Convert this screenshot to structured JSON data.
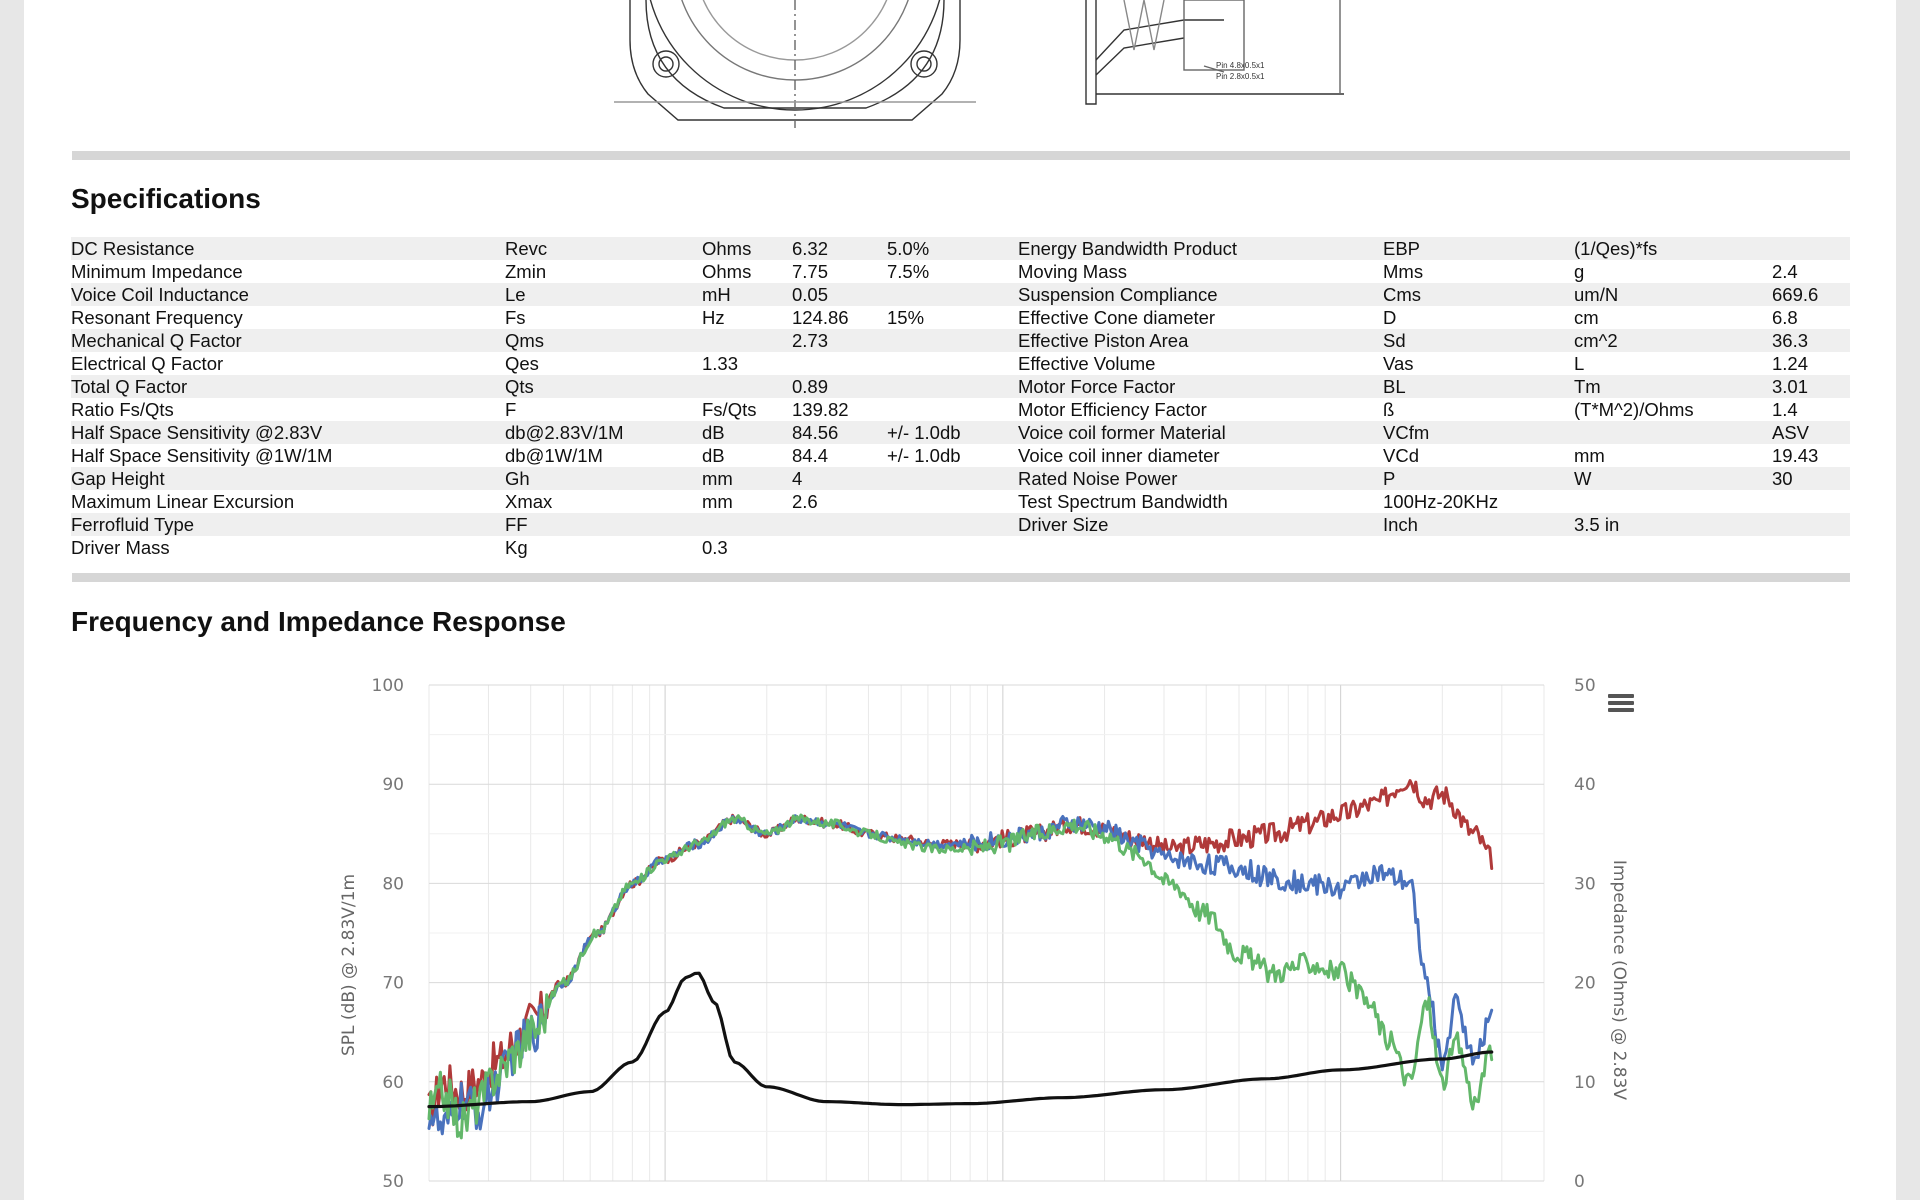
{
  "sections": {
    "specifications_title": "Specifications",
    "response_title": "Frequency and Impedance Response"
  },
  "drawing": {
    "note_line1": "Pin 4.8x0.5x1",
    "note_line2": "Pin 2.8x0.5x1"
  },
  "spec_rows": [
    [
      "DC Resistance",
      "Revc",
      "Ohms",
      "6.32",
      "5.0%",
      "Energy Bandwidth Product",
      "EBP",
      "(1/Qes)*fs",
      ""
    ],
    [
      "Minimum Impedance",
      "Zmin",
      "Ohms",
      "7.75",
      "7.5%",
      "Moving Mass",
      "Mms",
      "g",
      "2.4"
    ],
    [
      "Voice Coil Inductance",
      "Le",
      "mH",
      "0.05",
      "",
      "Suspension Compliance",
      "Cms",
      "um/N",
      "669.6"
    ],
    [
      "Resonant Frequency",
      "Fs",
      "Hz",
      "124.86",
      "15%",
      "Effective Cone diameter",
      "D",
      "cm",
      "6.8"
    ],
    [
      "Mechanical Q Factor",
      "Qms",
      "",
      "2.73",
      "",
      "Effective Piston Area",
      "Sd",
      "cm^2",
      "36.3"
    ],
    [
      "Electrical Q Factor",
      "Qes",
      "1.33",
      "",
      "",
      "Effective Volume",
      "Vas",
      "L",
      "1.24"
    ],
    [
      "Total Q Factor",
      "Qts",
      "",
      "0.89",
      "",
      "Motor Force Factor",
      "BL",
      "Tm",
      "3.01"
    ],
    [
      "Ratio Fs/Qts",
      "F",
      "Fs/Qts",
      "139.82",
      "",
      "Motor Efficiency Factor",
      "ß",
      "(T*M^2)/Ohms",
      "1.4"
    ],
    [
      "Half Space Sensitivity @2.83V",
      "db@2.83V/1M",
      "dB",
      "84.56",
      "+/- 1.0db",
      "Voice coil former Material",
      "VCfm",
      "",
      "ASV"
    ],
    [
      "Half Space Sensitivity @1W/1M",
      "db@1W/1M",
      "dB",
      "84.4",
      "+/- 1.0db",
      "Voice coil inner diameter",
      "VCd",
      "mm",
      "19.43"
    ],
    [
      "Gap Height",
      "Gh",
      "mm",
      "4",
      "",
      "Rated Noise Power",
      "P",
      "W",
      "30"
    ],
    [
      "Maximum Linear Excursion",
      "Xmax",
      "mm",
      "2.6",
      "",
      "Test Spectrum Bandwidth",
      "100Hz-20KHz",
      "",
      ""
    ],
    [
      "Ferrofluid Type",
      "FF",
      "",
      "",
      "",
      "Driver Size",
      "Inch",
      "3.5 in",
      ""
    ],
    [
      "Driver Mass",
      "Kg",
      "0.3",
      "",
      "",
      "",
      "",
      "",
      ""
    ]
  ],
  "chart_data": {
    "type": "line",
    "xlabel": "",
    "ylabel": "SPL (dB) @ 2.83V/1m",
    "y2label": "Impedance (Ohms) @ 2.83V",
    "ylim": [
      50,
      100
    ],
    "y2lim": [
      0,
      50
    ],
    "yticks": [
      "100",
      "90",
      "80",
      "70",
      "60",
      "50"
    ],
    "y2ticks": [
      "50",
      "40",
      "30",
      "20",
      "10",
      "0"
    ],
    "xlim_hz": [
      20,
      40000
    ],
    "grid": true,
    "colors": {
      "red": "#b03a3a",
      "blue": "#4a72bd",
      "green": "#63b76a",
      "impedance": "#111111"
    },
    "series": [
      {
        "color_name": "red",
        "axis": "left",
        "points": [
          [
            20,
            57
          ],
          [
            22,
            60
          ],
          [
            25,
            59
          ],
          [
            28,
            60
          ],
          [
            32,
            62
          ],
          [
            36,
            64
          ],
          [
            40,
            66
          ],
          [
            50,
            70
          ],
          [
            63,
            75
          ],
          [
            80,
            80
          ],
          [
            100,
            82.5
          ],
          [
            125,
            84
          ],
          [
            160,
            86.5
          ],
          [
            200,
            85
          ],
          [
            250,
            86.5
          ],
          [
            315,
            86
          ],
          [
            400,
            85
          ],
          [
            500,
            84.5
          ],
          [
            630,
            84
          ],
          [
            800,
            84
          ],
          [
            1000,
            84.5
          ],
          [
            1250,
            85
          ],
          [
            1600,
            86
          ],
          [
            2000,
            85.5
          ],
          [
            2500,
            84.5
          ],
          [
            3150,
            83.5
          ],
          [
            4000,
            84
          ],
          [
            5000,
            84.5
          ],
          [
            6300,
            85
          ],
          [
            8000,
            86
          ],
          [
            10000,
            87
          ],
          [
            12500,
            88
          ],
          [
            16000,
            90.5
          ],
          [
            18000,
            88.5
          ],
          [
            20000,
            89
          ],
          [
            25000,
            85
          ],
          [
            28000,
            82.5
          ]
        ]
      },
      {
        "color_name": "blue",
        "axis": "left",
        "points": [
          [
            20,
            57
          ],
          [
            22,
            55
          ],
          [
            25,
            58
          ],
          [
            28,
            57
          ],
          [
            32,
            60
          ],
          [
            36,
            63
          ],
          [
            40,
            65
          ],
          [
            50,
            70
          ],
          [
            63,
            75
          ],
          [
            80,
            80
          ],
          [
            100,
            82.5
          ],
          [
            125,
            84
          ],
          [
            160,
            86.5
          ],
          [
            200,
            85
          ],
          [
            250,
            86.5
          ],
          [
            315,
            86
          ],
          [
            400,
            85
          ],
          [
            500,
            84.5
          ],
          [
            630,
            84
          ],
          [
            800,
            84
          ],
          [
            1000,
            84.5
          ],
          [
            1250,
            85
          ],
          [
            1600,
            86
          ],
          [
            2000,
            85.5
          ],
          [
            2500,
            84
          ],
          [
            3150,
            82.5
          ],
          [
            4000,
            82
          ],
          [
            5000,
            81.5
          ],
          [
            6300,
            80.5
          ],
          [
            8000,
            80
          ],
          [
            10000,
            79.5
          ],
          [
            12500,
            81
          ],
          [
            16000,
            80
          ],
          [
            18000,
            70
          ],
          [
            20000,
            62
          ],
          [
            22000,
            68
          ],
          [
            25000,
            62
          ],
          [
            28000,
            67
          ]
        ]
      },
      {
        "color_name": "green",
        "axis": "left",
        "points": [
          [
            20,
            57
          ],
          [
            22,
            59
          ],
          [
            25,
            56
          ],
          [
            28,
            58
          ],
          [
            32,
            61
          ],
          [
            36,
            63
          ],
          [
            40,
            65
          ],
          [
            50,
            70
          ],
          [
            63,
            75
          ],
          [
            80,
            80
          ],
          [
            100,
            82.5
          ],
          [
            125,
            84
          ],
          [
            160,
            86.5
          ],
          [
            200,
            85
          ],
          [
            250,
            86.5
          ],
          [
            315,
            86
          ],
          [
            400,
            85
          ],
          [
            500,
            84
          ],
          [
            630,
            83.5
          ],
          [
            800,
            83.5
          ],
          [
            1000,
            84
          ],
          [
            1250,
            85
          ],
          [
            1600,
            86
          ],
          [
            2000,
            85
          ],
          [
            2500,
            83
          ],
          [
            3150,
            80
          ],
          [
            4000,
            77
          ],
          [
            5000,
            73
          ],
          [
            6300,
            71
          ],
          [
            8000,
            72
          ],
          [
            10000,
            71
          ],
          [
            12000,
            68
          ],
          [
            14000,
            64
          ],
          [
            16000,
            60
          ],
          [
            18000,
            68
          ],
          [
            20000,
            60
          ],
          [
            22000,
            64
          ],
          [
            25000,
            58
          ],
          [
            28000,
            63
          ]
        ]
      },
      {
        "color_name": "impedance",
        "axis": "right",
        "points": [
          [
            20,
            7.5
          ],
          [
            40,
            8
          ],
          [
            60,
            9
          ],
          [
            80,
            12
          ],
          [
            100,
            17
          ],
          [
            115,
            20.5
          ],
          [
            125,
            21
          ],
          [
            140,
            18
          ],
          [
            160,
            12
          ],
          [
            200,
            9.5
          ],
          [
            300,
            8
          ],
          [
            500,
            7.7
          ],
          [
            800,
            7.8
          ],
          [
            1500,
            8.4
          ],
          [
            3000,
            9.2
          ],
          [
            6000,
            10.3
          ],
          [
            10000,
            11.2
          ],
          [
            20000,
            12.3
          ],
          [
            28000,
            13
          ]
        ]
      }
    ]
  }
}
